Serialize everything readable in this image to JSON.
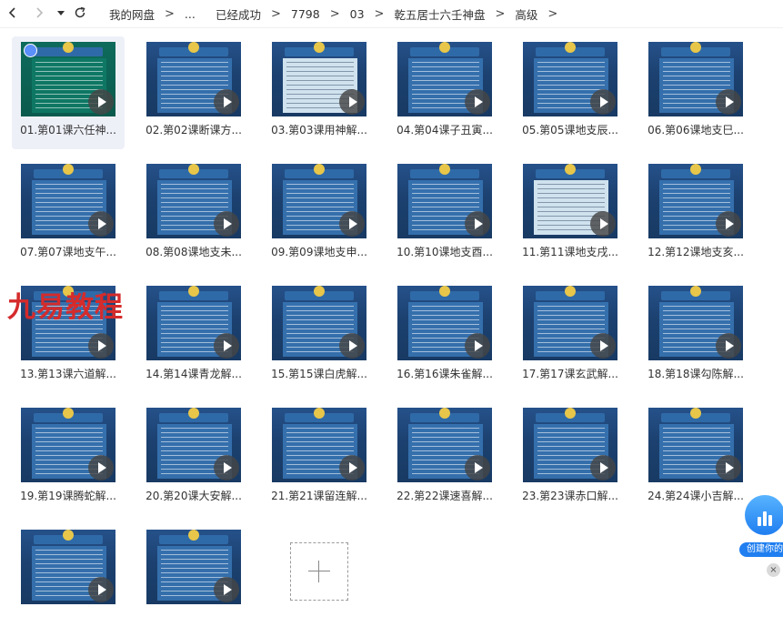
{
  "breadcrumb": [
    "我的网盘",
    "...",
    "已经成功",
    "7798",
    "03",
    "乾五居士六壬神盘",
    "高级"
  ],
  "files": [
    "01.第01课六任神...",
    "02.第02课断课方...",
    "03.第03课用神解...",
    "04.第04课子丑寅...",
    "05.第05课地支辰...",
    "06.第06课地支巳...",
    "07.第07课地支午...",
    "08.第08课地支未...",
    "09.第09课地支申...",
    "10.第10课地支酉...",
    "11.第11课地支戌...",
    "12.第12课地支亥...",
    "13.第13课六道解...",
    "14.第14课青龙解...",
    "15.第15课白虎解...",
    "16.第16课朱雀解...",
    "17.第17课玄武解...",
    "18.第18课勾陈解...",
    "19.第19课腾蛇解...",
    "20.第20课大安解...",
    "21.第21课留连解...",
    "22.第22课速喜解...",
    "23.第23课赤口解...",
    "24.第24课小吉解...",
    "",
    ""
  ],
  "watermark": "九易教程",
  "float_button_label": "创建你的",
  "close_glyph": "×",
  "colors": {
    "accent": "#5b8ff9",
    "watermark": "#d52b2b",
    "float": "#1f7ef0"
  }
}
